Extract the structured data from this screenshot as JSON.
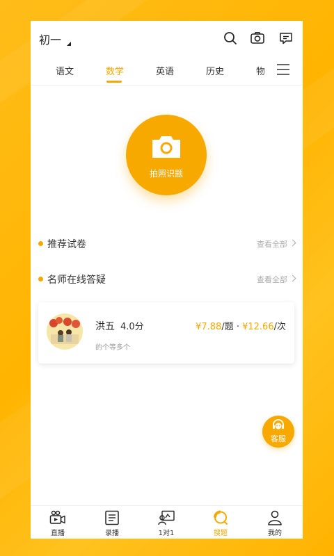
{
  "header": {
    "grade": "初一"
  },
  "tabs": [
    {
      "label": "语文"
    },
    {
      "label": "数学",
      "active": true
    },
    {
      "label": "英语"
    },
    {
      "label": "历史"
    },
    {
      "label": "物"
    }
  ],
  "icons": {
    "search": "search-icon",
    "camera": "camera-icon",
    "message": "message-icon",
    "menu": "menu-icon"
  },
  "camera_button": {
    "label": "拍照识题"
  },
  "sections": {
    "recommended_papers": {
      "title": "推荐试卷",
      "see_all": "查看全部"
    },
    "online_teachers": {
      "title": "名师在线答疑",
      "see_all": "查看全部"
    }
  },
  "teacher": {
    "name": "洪五",
    "rating": "4.0分",
    "price_per_question": "¥7.88",
    "per_question_unit": "/题 · ",
    "price_per_session": "¥12.66",
    "per_session_unit": "/次",
    "description": "的个等多个"
  },
  "service_button": {
    "label": "客服"
  },
  "bottom_nav": [
    {
      "label": "直播",
      "icon": "live-video-icon"
    },
    {
      "label": "录播",
      "icon": "recorded-book-icon"
    },
    {
      "label": "1对1",
      "icon": "one-on-one-icon"
    },
    {
      "label": "搜题",
      "icon": "search-question-icon",
      "active": true
    },
    {
      "label": "我的",
      "icon": "profile-icon"
    }
  ],
  "colors": {
    "accent": "#f5a800",
    "background": "#ffb400"
  }
}
